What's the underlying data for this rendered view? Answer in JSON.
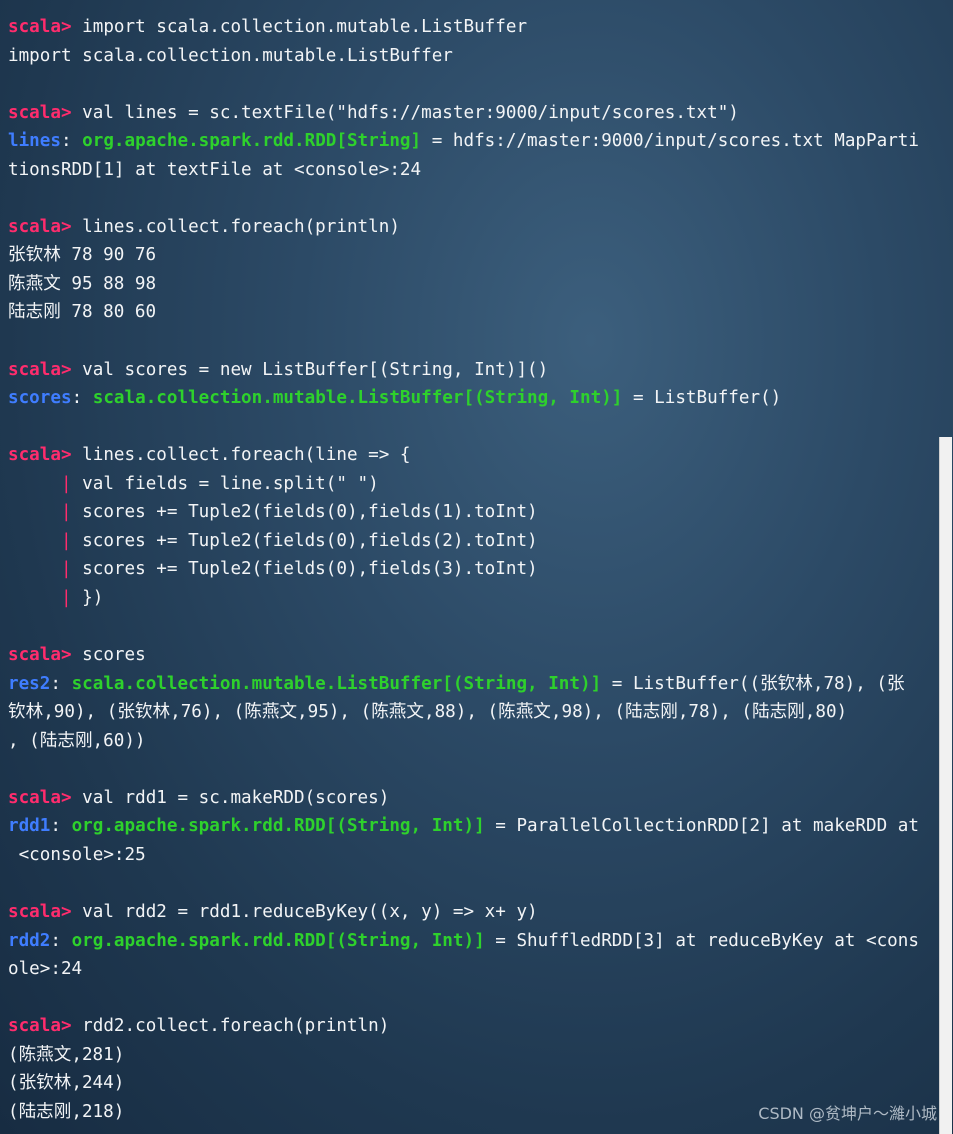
{
  "terminal": {
    "prompt": "scala>",
    "lines": [
      [
        {
          "k": "prompt",
          "t": "scala>"
        },
        {
          "k": "txt",
          "t": " import scala.collection.mutable.ListBuffer"
        }
      ],
      [
        {
          "k": "txt",
          "t": "import scala.collection.mutable.ListBuffer"
        }
      ],
      [],
      [
        {
          "k": "prompt",
          "t": "scala>"
        },
        {
          "k": "txt",
          "t": " val lines = sc.textFile(\"hdfs://master:9000/input/scores.txt\")"
        }
      ],
      [
        {
          "k": "varname",
          "t": "lines"
        },
        {
          "k": "txt",
          "t": ": "
        },
        {
          "k": "type",
          "t": "org.apache.spark.rdd.RDD[String]"
        },
        {
          "k": "txt",
          "t": " = hdfs://master:9000/input/scores.txt MapParti"
        }
      ],
      [
        {
          "k": "txt",
          "t": "tionsRDD[1] at textFile at <console>:24"
        }
      ],
      [],
      [
        {
          "k": "prompt",
          "t": "scala>"
        },
        {
          "k": "txt",
          "t": " lines.collect.foreach(println)"
        }
      ],
      [
        {
          "k": "txt",
          "t": "张钦林 78 90 76"
        }
      ],
      [
        {
          "k": "txt",
          "t": "陈燕文 95 88 98"
        }
      ],
      [
        {
          "k": "txt",
          "t": "陆志刚 78 80 60"
        }
      ],
      [],
      [
        {
          "k": "prompt",
          "t": "scala>"
        },
        {
          "k": "txt",
          "t": " val scores = new ListBuffer[(String, Int)]()"
        }
      ],
      [
        {
          "k": "varname",
          "t": "scores"
        },
        {
          "k": "txt",
          "t": ": "
        },
        {
          "k": "type",
          "t": "scala.collection.mutable.ListBuffer[(String, Int)]"
        },
        {
          "k": "txt",
          "t": " = ListBuffer()"
        }
      ],
      [],
      [
        {
          "k": "prompt",
          "t": "scala>"
        },
        {
          "k": "txt",
          "t": " lines.collect.foreach(line => {"
        }
      ],
      [
        {
          "k": "txt",
          "t": "     "
        },
        {
          "k": "pipe",
          "t": "|"
        },
        {
          "k": "txt",
          "t": " val fields = line.split(\" \")"
        }
      ],
      [
        {
          "k": "txt",
          "t": "     "
        },
        {
          "k": "pipe",
          "t": "|"
        },
        {
          "k": "txt",
          "t": " scores += Tuple2(fields(0),fields(1).toInt)"
        }
      ],
      [
        {
          "k": "txt",
          "t": "     "
        },
        {
          "k": "pipe",
          "t": "|"
        },
        {
          "k": "txt",
          "t": " scores += Tuple2(fields(0),fields(2).toInt)"
        }
      ],
      [
        {
          "k": "txt",
          "t": "     "
        },
        {
          "k": "pipe",
          "t": "|"
        },
        {
          "k": "txt",
          "t": " scores += Tuple2(fields(0),fields(3).toInt)"
        }
      ],
      [
        {
          "k": "txt",
          "t": "     "
        },
        {
          "k": "pipe",
          "t": "|"
        },
        {
          "k": "txt",
          "t": " })"
        }
      ],
      [],
      [
        {
          "k": "prompt",
          "t": "scala>"
        },
        {
          "k": "txt",
          "t": " scores"
        }
      ],
      [
        {
          "k": "varname",
          "t": "res2"
        },
        {
          "k": "txt",
          "t": ": "
        },
        {
          "k": "type",
          "t": "scala.collection.mutable.ListBuffer[(String, Int)]"
        },
        {
          "k": "txt",
          "t": " = ListBuffer((张钦林,78), (张"
        }
      ],
      [
        {
          "k": "txt",
          "t": "钦林,90), (张钦林,76), (陈燕文,95), (陈燕文,88), (陈燕文,98), (陆志刚,78), (陆志刚,80)"
        }
      ],
      [
        {
          "k": "txt",
          "t": ", (陆志刚,60))"
        }
      ],
      [],
      [
        {
          "k": "prompt",
          "t": "scala>"
        },
        {
          "k": "txt",
          "t": " val rdd1 = sc.makeRDD(scores)"
        }
      ],
      [
        {
          "k": "varname",
          "t": "rdd1"
        },
        {
          "k": "txt",
          "t": ": "
        },
        {
          "k": "type",
          "t": "org.apache.spark.rdd.RDD[(String, Int)]"
        },
        {
          "k": "txt",
          "t": " = ParallelCollectionRDD[2] at makeRDD at"
        }
      ],
      [
        {
          "k": "txt",
          "t": " <console>:25"
        }
      ],
      [],
      [
        {
          "k": "prompt",
          "t": "scala>"
        },
        {
          "k": "txt",
          "t": " val rdd2 = rdd1.reduceByKey((x, y) => x+ y)"
        }
      ],
      [
        {
          "k": "varname",
          "t": "rdd2"
        },
        {
          "k": "txt",
          "t": ": "
        },
        {
          "k": "type",
          "t": "org.apache.spark.rdd.RDD[(String, Int)]"
        },
        {
          "k": "txt",
          "t": " = ShuffledRDD[3] at reduceByKey at <cons"
        }
      ],
      [
        {
          "k": "txt",
          "t": "ole>:24"
        }
      ],
      [],
      [
        {
          "k": "prompt",
          "t": "scala>"
        },
        {
          "k": "txt",
          "t": " rdd2.collect.foreach(println)"
        }
      ],
      [
        {
          "k": "txt",
          "t": "(陈燕文,281)"
        }
      ],
      [
        {
          "k": "txt",
          "t": "(张钦林,244)"
        }
      ],
      [
        {
          "k": "txt",
          "t": "(陆志刚,218)"
        }
      ]
    ]
  },
  "watermark": "CSDN @贫坤户～濰小城",
  "colors": {
    "prompt": "#ff2c6d",
    "variable": "#3f7dff",
    "type": "#2ed12c",
    "text": "#f2f4f6"
  }
}
